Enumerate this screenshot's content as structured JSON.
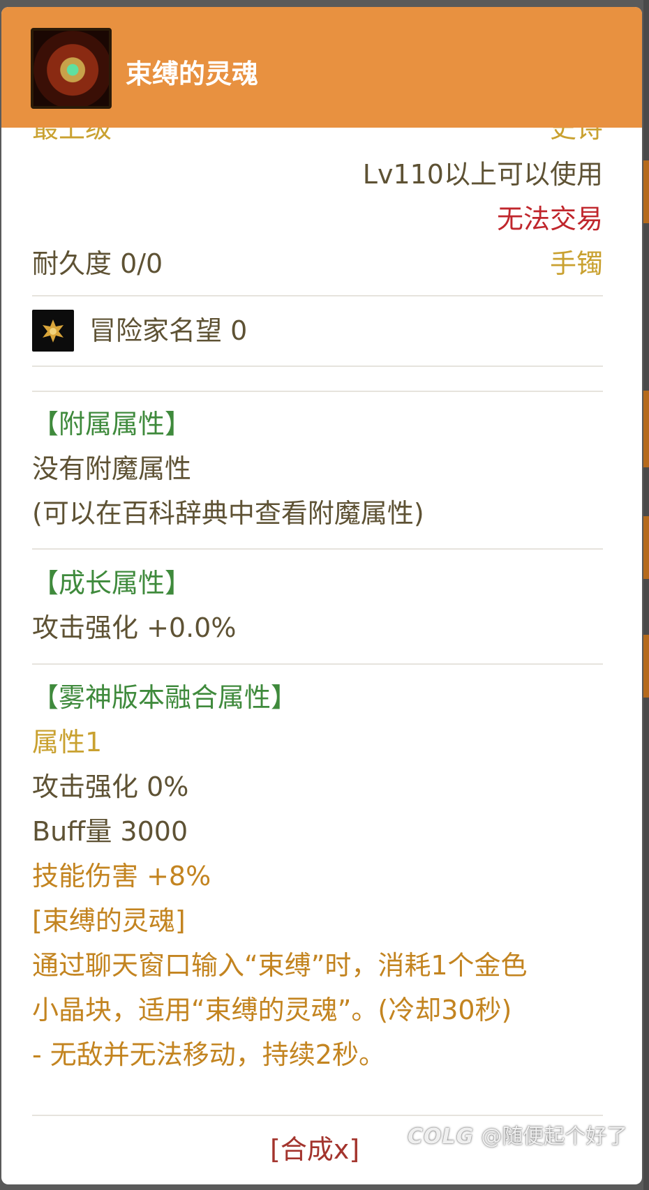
{
  "item": {
    "name": "束缚的灵魂",
    "icon": "bound-soul-item-icon"
  },
  "info": {
    "grade": "最上级",
    "rarity": "史诗",
    "level_req": "Lv110以上可以使用",
    "trade": "无法交易",
    "durability": "耐久度 0/0",
    "slot": "手镯"
  },
  "fame": {
    "icon": "adventurer-fame-icon",
    "label": "冒险家名望 0"
  },
  "enchant": {
    "header": "【附属属性】",
    "line1": "没有附魔属性",
    "line2": "(可以在百科辞典中查看附魔属性)"
  },
  "growth": {
    "header": "【成长属性】",
    "line1": "攻击强化 +0.0%"
  },
  "fusion": {
    "header": "【雾神版本融合属性】",
    "attr_title": "属性1",
    "attack": "攻击强化 0%",
    "buff": "Buff量 3000",
    "skill_damage": "技能伤害 +8%",
    "effect_name": "[束缚的灵魂]",
    "desc1": "通过聊天窗口输入“束缚”时，消耗1个金色",
    "desc2": "小晶块，适用“束缚的灵魂”。(冷却30秒)",
    "desc3": "- 无敌并无法移动，持续2秒。"
  },
  "footer": {
    "synth_button": "[合成x]"
  },
  "watermark": {
    "logo": "COLG",
    "text": "@随便起个好了"
  },
  "colors": {
    "header": "#e89140",
    "gold": "#c9a130",
    "red": "#c0262c",
    "green": "#3f8a3c",
    "orange": "#c38420"
  }
}
